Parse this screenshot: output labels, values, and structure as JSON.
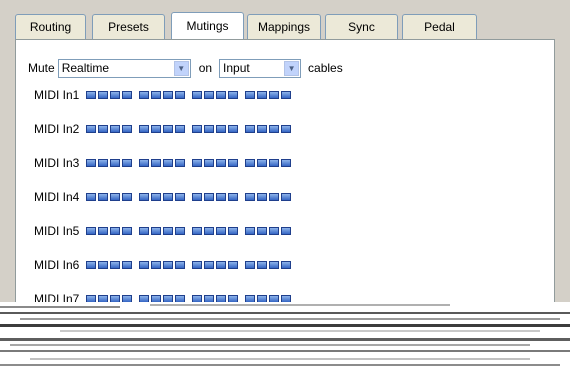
{
  "tabs": [
    {
      "label": "Routing",
      "active": false
    },
    {
      "label": "Presets",
      "active": false
    },
    {
      "label": "Mutings",
      "active": true
    },
    {
      "label": "Mappings",
      "active": false
    },
    {
      "label": "Sync",
      "active": false
    },
    {
      "label": "Pedal",
      "active": false
    }
  ],
  "controls": {
    "mute_label": "Mute",
    "mute_select_value": "Realtime",
    "on_label": "on",
    "cable_select_value": "Input",
    "cables_label": "cables"
  },
  "midi_rows": [
    {
      "label": "MIDI In1"
    },
    {
      "label": "MIDI In2"
    },
    {
      "label": "MIDI In3"
    },
    {
      "label": "MIDI In4"
    },
    {
      "label": "MIDI In5"
    },
    {
      "label": "MIDI In6"
    },
    {
      "label": "MIDI In7"
    }
  ],
  "colors": {
    "window_bg": "#d4d0c8",
    "tab_border": "#7f9db9",
    "checkbox_blue": "#3566c4"
  }
}
